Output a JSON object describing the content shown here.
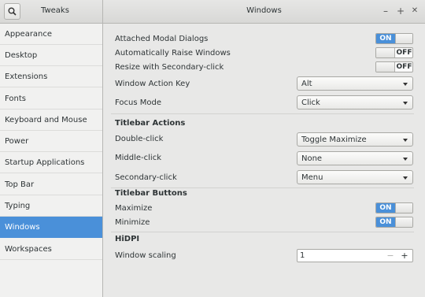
{
  "app": {
    "title": "Tweaks"
  },
  "window": {
    "title": "Windows",
    "minimize": "–",
    "maximize": "+",
    "close": "✕"
  },
  "search": {
    "icon": "search-icon"
  },
  "sidebar": {
    "items": [
      {
        "label": "Appearance",
        "active": false
      },
      {
        "label": "Desktop",
        "active": false
      },
      {
        "label": "Extensions",
        "active": false
      },
      {
        "label": "Fonts",
        "active": false
      },
      {
        "label": "Keyboard and Mouse",
        "active": false
      },
      {
        "label": "Power",
        "active": false
      },
      {
        "label": "Startup Applications",
        "active": false
      },
      {
        "label": "Top Bar",
        "active": false
      },
      {
        "label": "Typing",
        "active": false
      },
      {
        "label": "Windows",
        "active": true
      },
      {
        "label": "Workspaces",
        "active": false
      }
    ]
  },
  "settings": {
    "attached_modal": {
      "label": "Attached Modal Dialogs",
      "state": "ON"
    },
    "auto_raise": {
      "label": "Automatically Raise Windows",
      "state": "OFF"
    },
    "resize_secondary": {
      "label": "Resize with Secondary-click",
      "state": "OFF"
    },
    "action_key": {
      "label": "Window Action Key",
      "value": "Alt"
    },
    "focus_mode": {
      "label": "Focus Mode",
      "value": "Click"
    }
  },
  "titlebar_actions": {
    "title": "Titlebar Actions",
    "double_click": {
      "label": "Double-click",
      "value": "Toggle Maximize"
    },
    "middle_click": {
      "label": "Middle-click",
      "value": "None"
    },
    "secondary_click": {
      "label": "Secondary-click",
      "value": "Menu"
    }
  },
  "titlebar_buttons": {
    "title": "Titlebar Buttons",
    "maximize": {
      "label": "Maximize",
      "state": "ON"
    },
    "minimize": {
      "label": "Minimize",
      "state": "ON"
    }
  },
  "hidpi": {
    "title": "HiDPI",
    "scaling": {
      "label": "Window scaling",
      "value": "1",
      "minus": "−",
      "plus": "+"
    }
  },
  "colors": {
    "accent": "#4a90d9",
    "background": "#e8e8e7",
    "sidebar": "#f1f1f0"
  }
}
